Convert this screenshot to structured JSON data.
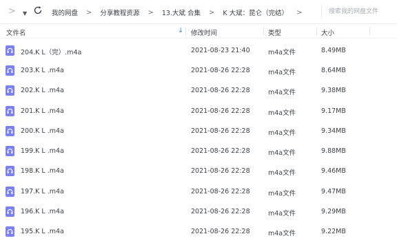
{
  "toolbar": {
    "breadcrumb": [
      "我的网盘",
      "分享教程资源",
      "13.大斌 合集",
      "K 大斌：昆仑（完结）"
    ],
    "search_placeholder": "搜索我的网盘文件"
  },
  "table": {
    "columns": [
      "文件名",
      "修改时间",
      "类型",
      "大小"
    ],
    "rows": [
      {
        "name": "204.K L（完）.m4a",
        "modified": "2021-08-23 21:40",
        "type": "m4a文件",
        "size": "8.49MB"
      },
      {
        "name": "203.K L .m4a",
        "modified": "2021-08-26 22:28",
        "type": "m4a文件",
        "size": "8.64MB"
      },
      {
        "name": "202.K L .m4a",
        "modified": "2021-08-26 22:28",
        "type": "m4a文件",
        "size": "9.38MB"
      },
      {
        "name": "201.K L .m4a",
        "modified": "2021-08-26 22:28",
        "type": "m4a文件",
        "size": "9.17MB"
      },
      {
        "name": "200.K L .m4a",
        "modified": "2021-08-26 22:28",
        "type": "m4a文件",
        "size": "9.34MB"
      },
      {
        "name": "199.K L .m4a",
        "modified": "2021-08-26 22:28",
        "type": "m4a文件",
        "size": "9.88MB"
      },
      {
        "name": "198.K L .m4a",
        "modified": "2021-08-26 22:28",
        "type": "m4a文件",
        "size": "9.46MB"
      },
      {
        "name": "197.K L .m4a",
        "modified": "2021-08-26 22:28",
        "type": "m4a文件",
        "size": "9.47MB"
      },
      {
        "name": "196.K L .m4a",
        "modified": "2021-08-26 22:28",
        "type": "m4a文件",
        "size": "9.29MB"
      },
      {
        "name": "195.K L .m4a",
        "modified": "2021-08-26 22:28",
        "type": "m4a文件",
        "size": "9.22MB"
      }
    ]
  }
}
